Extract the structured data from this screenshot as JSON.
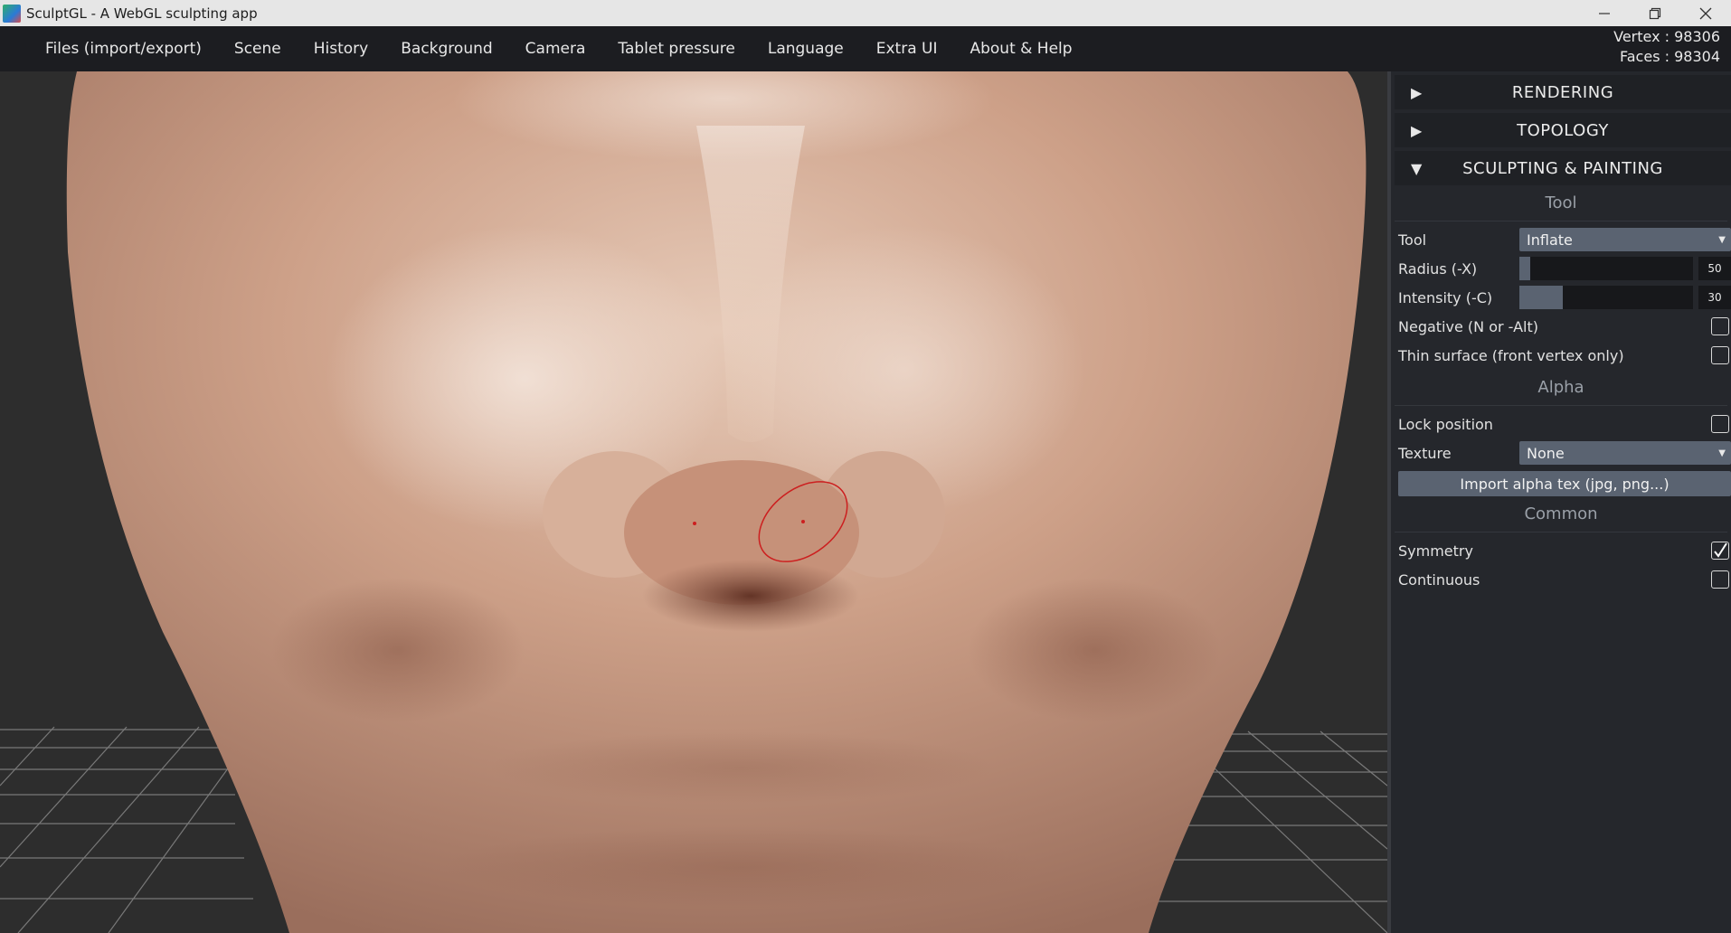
{
  "window": {
    "title": "SculptGL - A WebGL sculpting app",
    "logo_icon": "sculptgl-logo"
  },
  "menu": {
    "items": [
      {
        "label": "Files (import/export)"
      },
      {
        "label": "Scene"
      },
      {
        "label": "History"
      },
      {
        "label": "Background"
      },
      {
        "label": "Camera"
      },
      {
        "label": "Tablet pressure"
      },
      {
        "label": "Language"
      },
      {
        "label": "Extra UI"
      },
      {
        "label": "About & Help"
      }
    ]
  },
  "stats": {
    "vertex": "Vertex : 98306",
    "faces": "Faces : 98304"
  },
  "panel": {
    "folders": [
      {
        "label": "RENDERING",
        "arrow": "▶",
        "expanded": false
      },
      {
        "label": "TOPOLOGY",
        "arrow": "▶",
        "expanded": false
      },
      {
        "label": "SCULPTING & PAINTING",
        "arrow": "▼",
        "expanded": true
      }
    ],
    "tool_section": {
      "title": "Tool",
      "tool_label": "Tool",
      "tool_value": "Inflate",
      "radius_label": "Radius (-X)",
      "radius_value": "50",
      "radius_level": 0.06,
      "intensity_label": "Intensity (-C)",
      "intensity_value": "30",
      "intensity_level": 0.25,
      "negative_label": "Negative (N or -Alt)",
      "negative_checked": false,
      "thin_label": "Thin surface (front vertex only)",
      "thin_checked": false
    },
    "alpha_section": {
      "title": "Alpha",
      "lock_label": "Lock position",
      "lock_checked": false,
      "texture_label": "Texture",
      "texture_value": "None",
      "import_button": "Import alpha tex (jpg, png...)"
    },
    "common_section": {
      "title": "Common",
      "symmetry_label": "Symmetry",
      "symmetry_checked": true,
      "continuous_label": "Continuous",
      "continuous_checked": false
    }
  },
  "colors": {
    "accent": "#5a6371",
    "panel_bg": "#25272c",
    "menu_bg": "#1c1d21",
    "skin": "#c99c83",
    "brush_cursor": "#cc1f1f"
  }
}
